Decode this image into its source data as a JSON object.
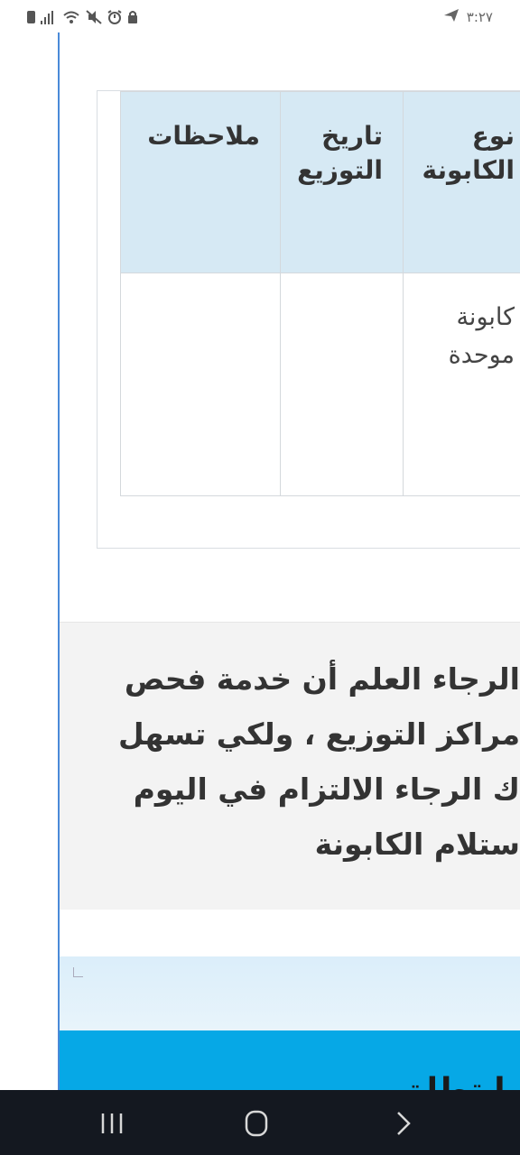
{
  "status_bar": {
    "time": "٣:٢٧",
    "icons": [
      "battery-icon",
      "signal-icon",
      "wifi-icon",
      "mute-icon",
      "alarm-icon",
      "lock-icon",
      "send-icon"
    ]
  },
  "table": {
    "headers": {
      "coupon_type": "نوع الكابونة",
      "distribution_date": "تاريخ التوزيع",
      "notes": "ملاحظات"
    },
    "rows": [
      {
        "coupon_type": "كابونة موحدة",
        "distribution_date": "",
        "notes": ""
      }
    ]
  },
  "notice": {
    "lines": [
      "الرجاء العلم أن خدمة فحص",
      "مراكز التوزيع ، ولكي تسهل",
      "ك الرجاء الالتزام في اليوم",
      "ستلام الكابونة"
    ]
  },
  "section": {
    "title": "وا تطلق"
  },
  "navbar": {
    "icons": [
      "recent-apps-icon",
      "home-icon",
      "back-icon"
    ]
  },
  "colors": {
    "header_bg": "#d6e9f4",
    "notice_bg": "#f3f3f3",
    "accent_blue": "#06a8e6",
    "nav_bg": "#141820"
  }
}
